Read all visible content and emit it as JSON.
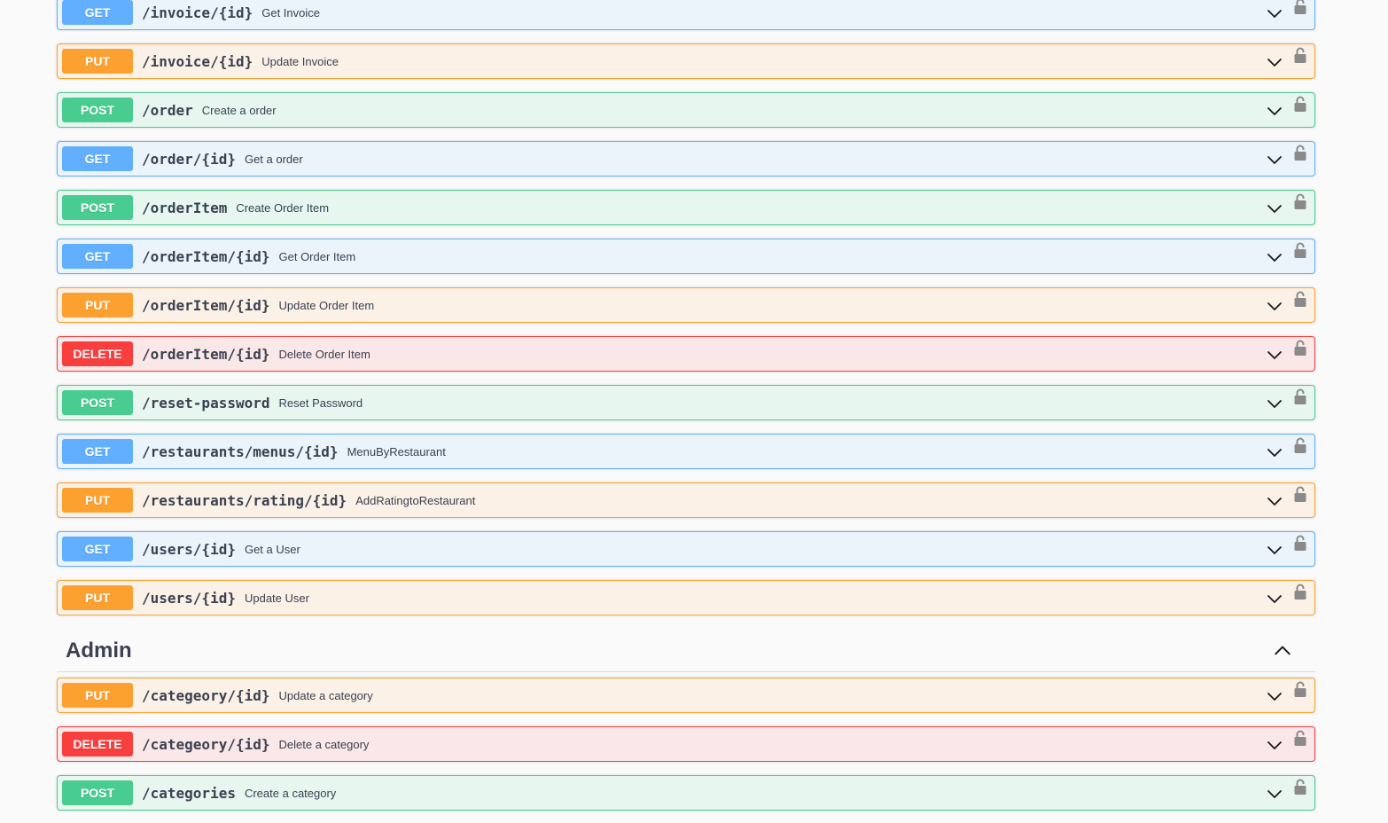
{
  "operations_top": [
    {
      "method": "GET",
      "cls": "get",
      "path": "/invoice/{id}",
      "summary": "Get Invoice"
    },
    {
      "method": "PUT",
      "cls": "put",
      "path": "/invoice/{id}",
      "summary": "Update Invoice"
    },
    {
      "method": "POST",
      "cls": "post",
      "path": "/order",
      "summary": "Create a order"
    },
    {
      "method": "GET",
      "cls": "get",
      "path": "/order/{id}",
      "summary": "Get a order"
    },
    {
      "method": "POST",
      "cls": "post",
      "path": "/orderItem",
      "summary": "Create Order Item"
    },
    {
      "method": "GET",
      "cls": "get",
      "path": "/orderItem/{id}",
      "summary": "Get Order Item"
    },
    {
      "method": "PUT",
      "cls": "put",
      "path": "/orderItem/{id}",
      "summary": "Update Order Item"
    },
    {
      "method": "DELETE",
      "cls": "delete",
      "path": "/orderItem/{id}",
      "summary": "Delete Order Item"
    },
    {
      "method": "POST",
      "cls": "post",
      "path": "/reset-password",
      "summary": "Reset Password"
    },
    {
      "method": "GET",
      "cls": "get",
      "path": "/restaurants/menus/{id}",
      "summary": "MenuByRestaurant"
    },
    {
      "method": "PUT",
      "cls": "put",
      "path": "/restaurants/rating/{id}",
      "summary": "AddRatingtoRestaurant"
    },
    {
      "method": "GET",
      "cls": "get",
      "path": "/users/{id}",
      "summary": "Get a User"
    },
    {
      "method": "PUT",
      "cls": "put",
      "path": "/users/{id}",
      "summary": "Update User"
    }
  ],
  "admin_tag": {
    "title": "Admin",
    "expanded_icon": "chevron-up-icon"
  },
  "operations_admin": [
    {
      "method": "PUT",
      "cls": "put",
      "path": "/categeory/{id}",
      "summary": "Update a category"
    },
    {
      "method": "DELETE",
      "cls": "delete",
      "path": "/categeory/{id}",
      "summary": "Delete a category"
    },
    {
      "method": "POST",
      "cls": "post",
      "path": "/categories",
      "summary": "Create a category"
    }
  ],
  "colors": {
    "get": "#61affe",
    "put": "#fca130",
    "post": "#49cc90",
    "delete": "#f93e3e",
    "text": "#3b4151"
  }
}
